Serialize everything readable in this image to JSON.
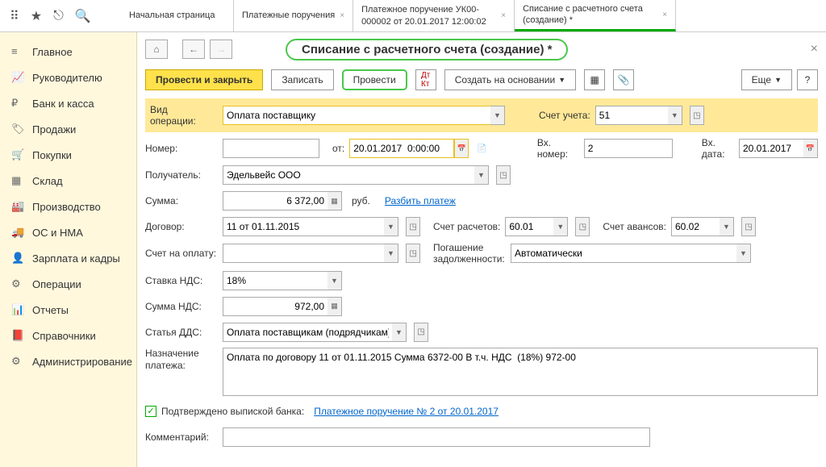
{
  "topIcons": [
    "apps",
    "star",
    "link",
    "search"
  ],
  "tabs": [
    {
      "label": "Начальная страница",
      "closable": false
    },
    {
      "label": "Платежные поручения",
      "closable": true
    },
    {
      "label": "Платежное поручение УК00-000002 от 20.01.2017 12:00:02",
      "closable": true
    },
    {
      "label": "Списание с расчетного счета (создание) *",
      "closable": true,
      "active": true
    }
  ],
  "sidebar": [
    {
      "label": "Главное",
      "icon": "menu"
    },
    {
      "label": "Руководителю",
      "icon": "chart"
    },
    {
      "label": "Банк и касса",
      "icon": "ruble"
    },
    {
      "label": "Продажи",
      "icon": "tag"
    },
    {
      "label": "Покупки",
      "icon": "cart"
    },
    {
      "label": "Склад",
      "icon": "boxes"
    },
    {
      "label": "Производство",
      "icon": "factory"
    },
    {
      "label": "ОС и НМА",
      "icon": "truck"
    },
    {
      "label": "Зарплата и кадры",
      "icon": "person"
    },
    {
      "label": "Операции",
      "icon": "ops"
    },
    {
      "label": "Отчеты",
      "icon": "report"
    },
    {
      "label": "Справочники",
      "icon": "book"
    },
    {
      "label": "Администрирование",
      "icon": "gear"
    }
  ],
  "title": "Списание с расчетного счета (создание) *",
  "toolbar": {
    "postClose": "Провести и закрыть",
    "write": "Записать",
    "post": "Провести",
    "createBased": "Создать на основании",
    "more": "Еще"
  },
  "labels": {
    "opType": "Вид операции:",
    "account": "Счет учета:",
    "number": "Номер:",
    "from": "от:",
    "inNumber": "Вх. номер:",
    "inDate": "Вх. дата:",
    "recipient": "Получатель:",
    "sum": "Сумма:",
    "rub": "руб.",
    "split": "Разбить платеж",
    "contract": "Договор:",
    "calcAcc": "Счет расчетов:",
    "advAcc": "Счет авансов:",
    "invoice": "Счет на оплату:",
    "repay": "Погашение задолженности:",
    "vatRate": "Ставка НДС:",
    "vatSum": "Сумма НДС:",
    "dds": "Статья ДДС:",
    "purpose": "Назначение платежа:",
    "confirmed": "Подтверждено выпиской банка:",
    "confirmedLink": "Платежное поручение № 2 от 20.01.2017",
    "comment": "Комментарий:"
  },
  "values": {
    "opType": "Оплата поставщику",
    "account": "51",
    "number": "",
    "date": "20.01.2017  0:00:00",
    "inNumber": "2",
    "inDate": "20.01.2017",
    "recipient": "Эдельвейс ООО",
    "sum": "6 372,00",
    "contract": "11 от 01.11.2015",
    "calcAcc": "60.01",
    "advAcc": "60.02",
    "invoice": "",
    "repay": "Автоматически",
    "vatRate": "18%",
    "vatSum": "972,00",
    "dds": "Оплата поставщикам (подрядчикам)",
    "purpose": "Оплата по договору 11 от 01.11.2015 Сумма 6372-00 В т.ч. НДС  (18%) 972-00",
    "comment": ""
  }
}
